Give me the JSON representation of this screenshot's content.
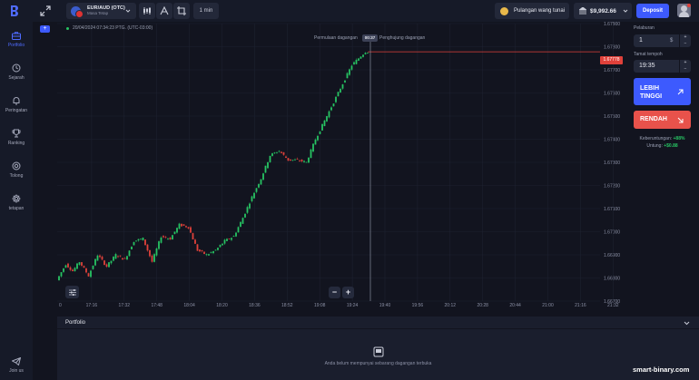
{
  "header": {
    "asset_name": "EUR/AUD (OTC)",
    "asset_sub": "Masa Tetap",
    "timeframe": "1 min",
    "cashback_label": "Pulangan wang tunai",
    "balance": "$9,992.66",
    "deposit_label": "Deposit"
  },
  "sidebar": {
    "items": [
      {
        "label": "Portfolio",
        "icon": "briefcase-icon",
        "active": true
      },
      {
        "label": "Sejarah",
        "icon": "history-icon"
      },
      {
        "label": "Peringatan",
        "icon": "bell-icon"
      },
      {
        "label": "Ranking",
        "icon": "trophy-icon"
      },
      {
        "label": "Tolong",
        "icon": "help-icon"
      },
      {
        "label": "tetapan",
        "icon": "settings-icon"
      }
    ],
    "join": "Join us"
  },
  "chart": {
    "datetime": "20/04/2024 07:34:23 PTG. (UTC-03:00)",
    "trade_start_label": "Permulaan dagangan",
    "trade_end_label": "Penghujung dagangan",
    "timer": "00:37",
    "current_price": "1.67778",
    "y_ticks": [
      "1.67900",
      "1.67800",
      "1.67700",
      "1.67600",
      "1.67500",
      "1.67400",
      "1.67300",
      "1.67200",
      "1.67100",
      "1.67000",
      "1.66900",
      "1.66800",
      "1.66700"
    ],
    "x_ticks": [
      "0",
      "17:16",
      "17:32",
      "17:48",
      "18:04",
      "18:20",
      "18:36",
      "18:52",
      "19:08",
      "19:24",
      "19:40",
      "19:56",
      "20:12",
      "20:28",
      "20:44",
      "21:00",
      "21:16",
      "21:32"
    ],
    "zoom_out": "−",
    "zoom_in": "+"
  },
  "chart_data": {
    "type": "candlestick",
    "y_range": [
      1.667,
      1.679
    ],
    "current_price": 1.67778,
    "trend_points": [
      [
        0,
        1.6679
      ],
      [
        4,
        1.6686
      ],
      [
        7,
        1.6683
      ],
      [
        10,
        1.6687
      ],
      [
        14,
        1.6681
      ],
      [
        18,
        1.669
      ],
      [
        22,
        1.6685
      ],
      [
        26,
        1.669
      ],
      [
        30,
        1.6688
      ],
      [
        34,
        1.6696
      ],
      [
        38,
        1.6697
      ],
      [
        42,
        1.6687
      ],
      [
        46,
        1.6698
      ],
      [
        50,
        1.6697
      ],
      [
        54,
        1.6703
      ],
      [
        58,
        1.6702
      ],
      [
        62,
        1.6692
      ],
      [
        66,
        1.669
      ],
      [
        70,
        1.6692
      ],
      [
        74,
        1.6696
      ],
      [
        78,
        1.6698
      ],
      [
        82,
        1.6706
      ],
      [
        86,
        1.6715
      ],
      [
        90,
        1.6723
      ],
      [
        94,
        1.6733
      ],
      [
        98,
        1.6735
      ],
      [
        102,
        1.6731
      ],
      [
        106,
        1.6731
      ],
      [
        110,
        1.673
      ],
      [
        114,
        1.674
      ],
      [
        118,
        1.6748
      ],
      [
        122,
        1.6756
      ],
      [
        126,
        1.6764
      ],
      [
        130,
        1.6772
      ],
      [
        134,
        1.6776
      ],
      [
        136,
        1.67778
      ]
    ]
  },
  "trade": {
    "amount_label": "Pelaburan",
    "amount": "1",
    "time_label": "Tamat tempoh",
    "time": "19:35",
    "higher_label": "LEBIH TINGGI",
    "lower_label": "RENDAH",
    "profit_label": "Keberuntungan:",
    "profit_pct": "+88%",
    "gain_label": "Untung:",
    "gain_value": "+$0.88"
  },
  "portfolio": {
    "title": "Portfolio",
    "empty": "Anda belum mempunyai sebarang dagangan terbuka"
  },
  "watermark": "smart-binary.com",
  "colors": {
    "accent": "#3d5afe",
    "bull": "#27c463",
    "bear": "#e0413a"
  }
}
